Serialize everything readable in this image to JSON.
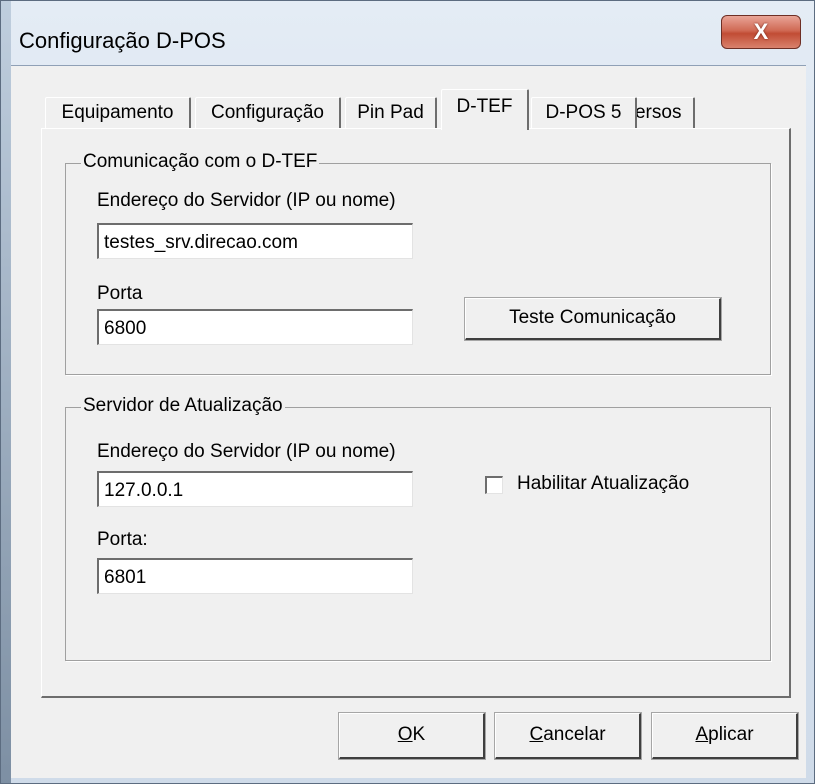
{
  "window": {
    "title": "Configuração D-POS",
    "close_glyph": "X"
  },
  "tabs": [
    {
      "label": "Equipamento",
      "active": false
    },
    {
      "label": "Configuração",
      "active": false
    },
    {
      "label": "Pin Pad",
      "active": false
    },
    {
      "label": "D-TEF",
      "active": true
    },
    {
      "label": "D-POS 5",
      "active": false
    },
    {
      "label": "Diversos",
      "active": false
    }
  ],
  "comunicacao": {
    "group_label": "Comunicação com o D-TEF",
    "server_label": "Endereço do Servidor (IP ou nome)",
    "server_value": "testes_srv.direcao.com",
    "port_label": "Porta",
    "port_value": "6800",
    "test_button": "Teste Comunicação"
  },
  "atualizacao": {
    "group_label": "Servidor de Atualização",
    "server_label": "Endereço do Servidor (IP ou nome)",
    "server_value": "127.0.0.1",
    "port_label": "Porta:",
    "port_value": "6801",
    "enable_label": "Habilitar Atualização",
    "enable_checked": false
  },
  "buttons": {
    "ok_mnemonic": "O",
    "ok_rest": "K",
    "cancel_mnemonic": "C",
    "cancel_rest": "ancelar",
    "apply_mnemonic": "A",
    "apply_rest": "plicar"
  }
}
